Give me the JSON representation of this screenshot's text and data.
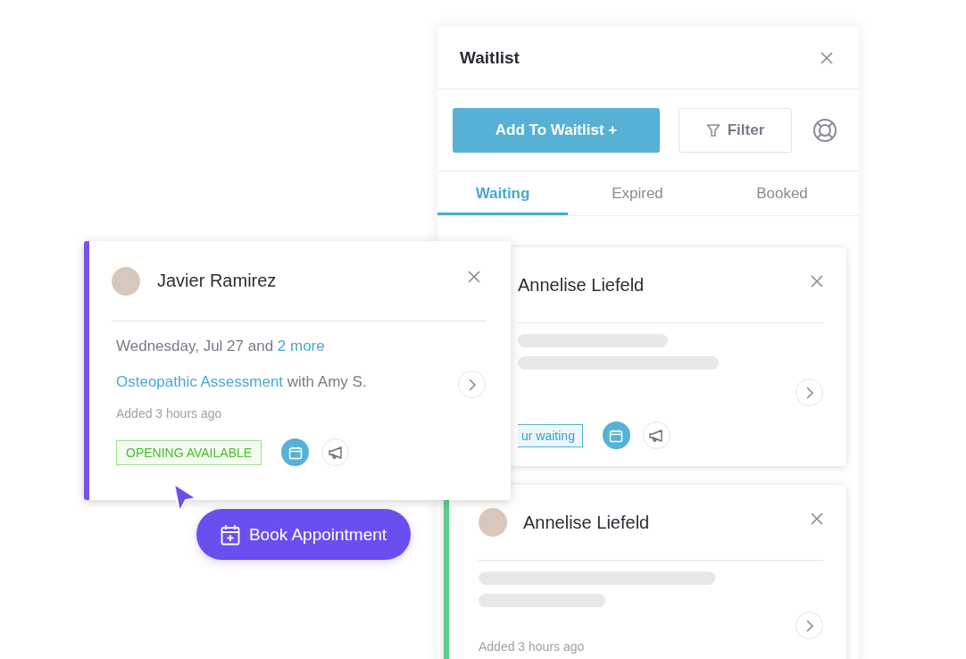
{
  "panel": {
    "title": "Waitlist",
    "add_button": "Add To Waitlist +",
    "filter_button": "Filter",
    "tabs": [
      {
        "label": "Waiting",
        "selected": true
      },
      {
        "label": "Expired",
        "selected": false
      },
      {
        "label": "Booked",
        "selected": false
      }
    ],
    "entries": [
      {
        "name": "Annelise Liefeld",
        "tag": "ur waiting",
        "avatar_shown": false
      },
      {
        "name": "Annelise Liefeld",
        "added": "Added 3 hours ago",
        "avatar_shown": true
      }
    ]
  },
  "popup_card": {
    "name": "Javier Ramirez",
    "date": "Wednesday, Jul 27 and",
    "more_link": "2 more",
    "service": "Osteopathic Assessment",
    "with_text": "with Amy S.",
    "added": "Added 3 hours ago",
    "status": "OPENING AVAILABLE"
  },
  "book_button": "Book Appointment"
}
